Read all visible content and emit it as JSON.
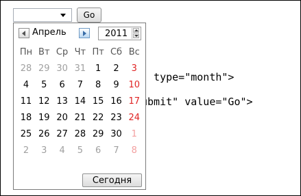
{
  "code": {
    "line1": "\" type=\"month\">",
    "line2": "ubmit\" value=\"Go\">"
  },
  "form": {
    "month_value": "",
    "go_label": "Go"
  },
  "calendar": {
    "month": "Апрель",
    "year": "2011",
    "weekdays": [
      "Пн",
      "Вт",
      "Ср",
      "Чт",
      "Пт",
      "Сб",
      "Вс"
    ],
    "weeks": [
      [
        "28",
        "29",
        "30",
        "31",
        "1",
        "2",
        "3"
      ],
      [
        "4",
        "5",
        "6",
        "7",
        "8",
        "9",
        "10"
      ],
      [
        "11",
        "12",
        "13",
        "14",
        "15",
        "16",
        "17"
      ],
      [
        "18",
        "19",
        "20",
        "21",
        "22",
        "23",
        "24"
      ],
      [
        "25",
        "26",
        "27",
        "28",
        "29",
        "30",
        "1"
      ],
      [
        "2",
        "3",
        "4",
        "5",
        "6",
        "7",
        "8"
      ]
    ],
    "today_label": "Сегодня",
    "colors": {
      "weekend": "#e02424",
      "other_month": "#a0a0a0",
      "other_month_weekend": "#f3a0a0"
    }
  }
}
